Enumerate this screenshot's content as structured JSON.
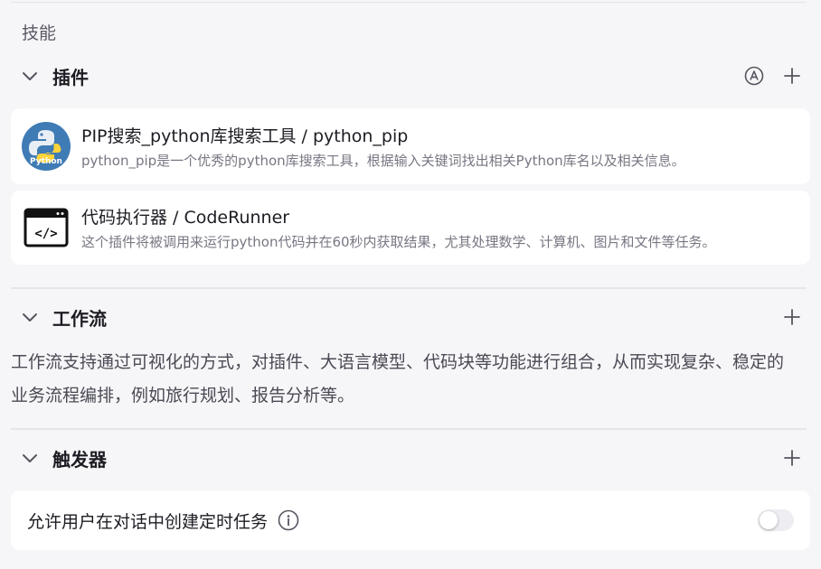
{
  "section": {
    "title": "技能"
  },
  "plugins": {
    "title": "插件",
    "items": [
      {
        "name": "PIP搜索_python库搜索工具 / python_pip",
        "description": "python_pip是一个优秀的python库搜索工具，根据输入关键词找出相关Python库名以及相关信息。",
        "logo_text": "Python",
        "icon": "python-logo"
      },
      {
        "name": "代码执行器 / CodeRunner",
        "description": "这个插件将被调用来运行python代码并在60秒内获取结果，尤其处理数学、计算机、图片和文件等任务。",
        "icon": "code-window"
      }
    ]
  },
  "workflow": {
    "title": "工作流",
    "description": "工作流支持通过可视化的方式，对插件、大语言模型、代码块等功能进行组合，从而实现复杂、稳定的业务流程编排，例如旅行规划、报告分析等。"
  },
  "trigger": {
    "title": "触发器",
    "option_label": "允许用户在对话中创建定时任务",
    "option_enabled": false
  },
  "colors": {
    "background": "#f6f6f8",
    "card": "#ffffff",
    "python_bg": "#3f7bb5",
    "python_yellow": "#ffd43b"
  }
}
